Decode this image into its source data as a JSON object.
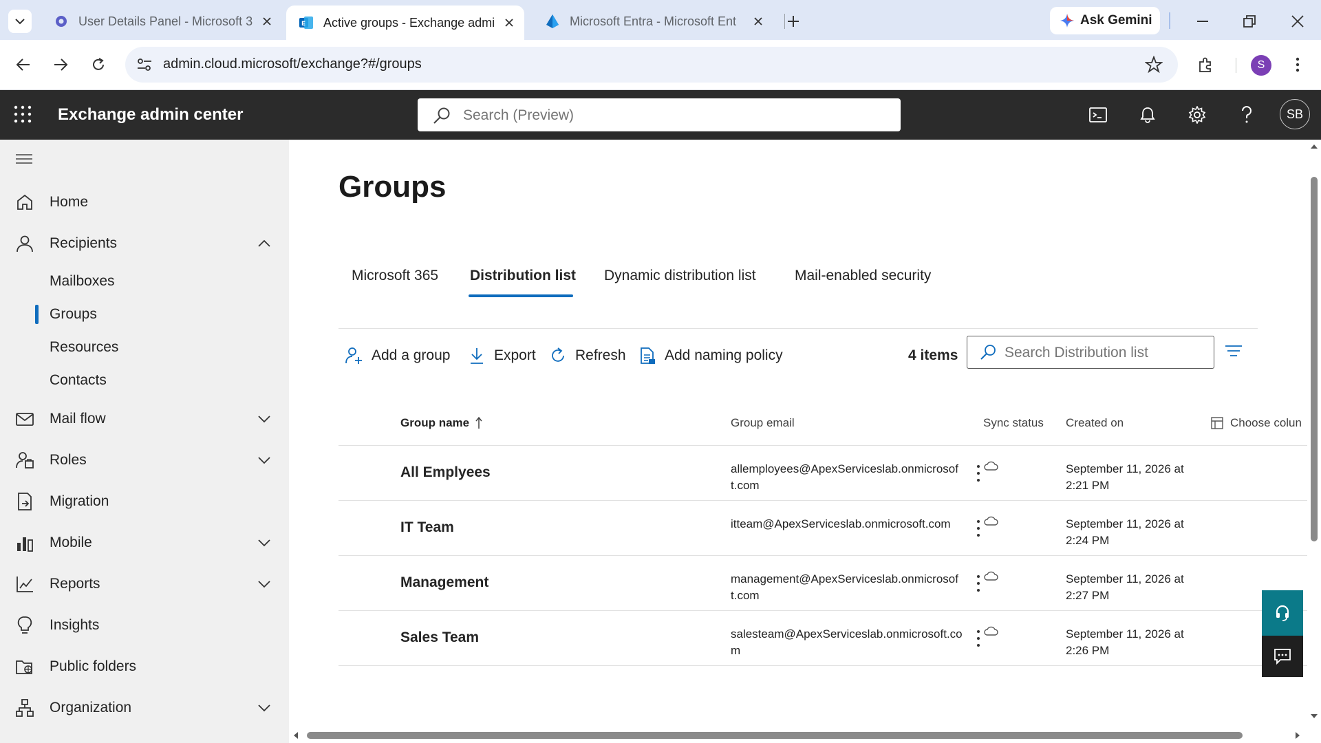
{
  "browser": {
    "tabs": [
      {
        "title": "User Details Panel - Microsoft 3",
        "icon": "gear-app-icon",
        "active": false
      },
      {
        "title": "Active groups - Exchange admi",
        "icon": "exchange-icon",
        "active": true
      },
      {
        "title": "Microsoft Entra - Microsoft Ent",
        "icon": "entra-icon",
        "active": false
      }
    ],
    "gemini_label": "Ask Gemini",
    "url": "admin.cloud.microsoft/exchange?#/groups",
    "profile_initial": "S"
  },
  "header": {
    "app_title": "Exchange admin center",
    "search_placeholder": "Search (Preview)",
    "user_initials": "SB"
  },
  "nav": {
    "items": [
      {
        "label": "Home",
        "icon": "home-icon"
      },
      {
        "label": "Recipients",
        "icon": "person-icon",
        "expanded": true
      },
      {
        "label": "Mail flow",
        "icon": "mail-icon"
      },
      {
        "label": "Roles",
        "icon": "roles-icon"
      },
      {
        "label": "Migration",
        "icon": "migration-icon"
      },
      {
        "label": "Mobile",
        "icon": "mobile-icon"
      },
      {
        "label": "Reports",
        "icon": "reports-icon"
      },
      {
        "label": "Insights",
        "icon": "lightbulb-icon"
      },
      {
        "label": "Public folders",
        "icon": "folders-icon"
      },
      {
        "label": "Organization",
        "icon": "organization-icon"
      }
    ],
    "recipients_sub": [
      "Mailboxes",
      "Groups",
      "Resources",
      "Contacts"
    ],
    "selected_sub": "Groups"
  },
  "page": {
    "title": "Groups",
    "tabs": [
      "Microsoft 365",
      "Distribution list",
      "Dynamic distribution list",
      "Mail-enabled security"
    ],
    "active_tab": "Distribution list",
    "commands": {
      "add_group": "Add a group",
      "export": "Export",
      "refresh": "Refresh",
      "naming_policy": "Add naming policy"
    },
    "item_count": "4 items",
    "search_placeholder": "Search Distribution list",
    "columns": {
      "group_name": "Group name",
      "group_email": "Group email",
      "sync_status": "Sync status",
      "created_on": "Created on",
      "choose_columns": "Choose colun"
    },
    "rows": [
      {
        "name": "All Emplyees",
        "email": "allemployees@ApexServiceslab.onmicrosoft.com",
        "created": "September 11, 2026 at 2:21 PM"
      },
      {
        "name": "IT Team",
        "email": "itteam@ApexServiceslab.onmicrosoft.com",
        "created": "September 11, 2026 at 2:24 PM"
      },
      {
        "name": "Management",
        "email": "management@ApexServiceslab.onmicrosoft.com",
        "created": "September 11, 2026 at 2:27 PM"
      },
      {
        "name": "Sales Team",
        "email": "salesteam@ApexServiceslab.onmicrosoft.com",
        "created": "September 11, 2026 at 2:26 PM"
      }
    ]
  },
  "colors": {
    "accent": "#0f6cbd",
    "header_bg": "#2b2b2b",
    "nav_bg": "#f0f0f0",
    "help_teal": "#0b7a89",
    "avatar_purple": "#7b3fb5"
  }
}
